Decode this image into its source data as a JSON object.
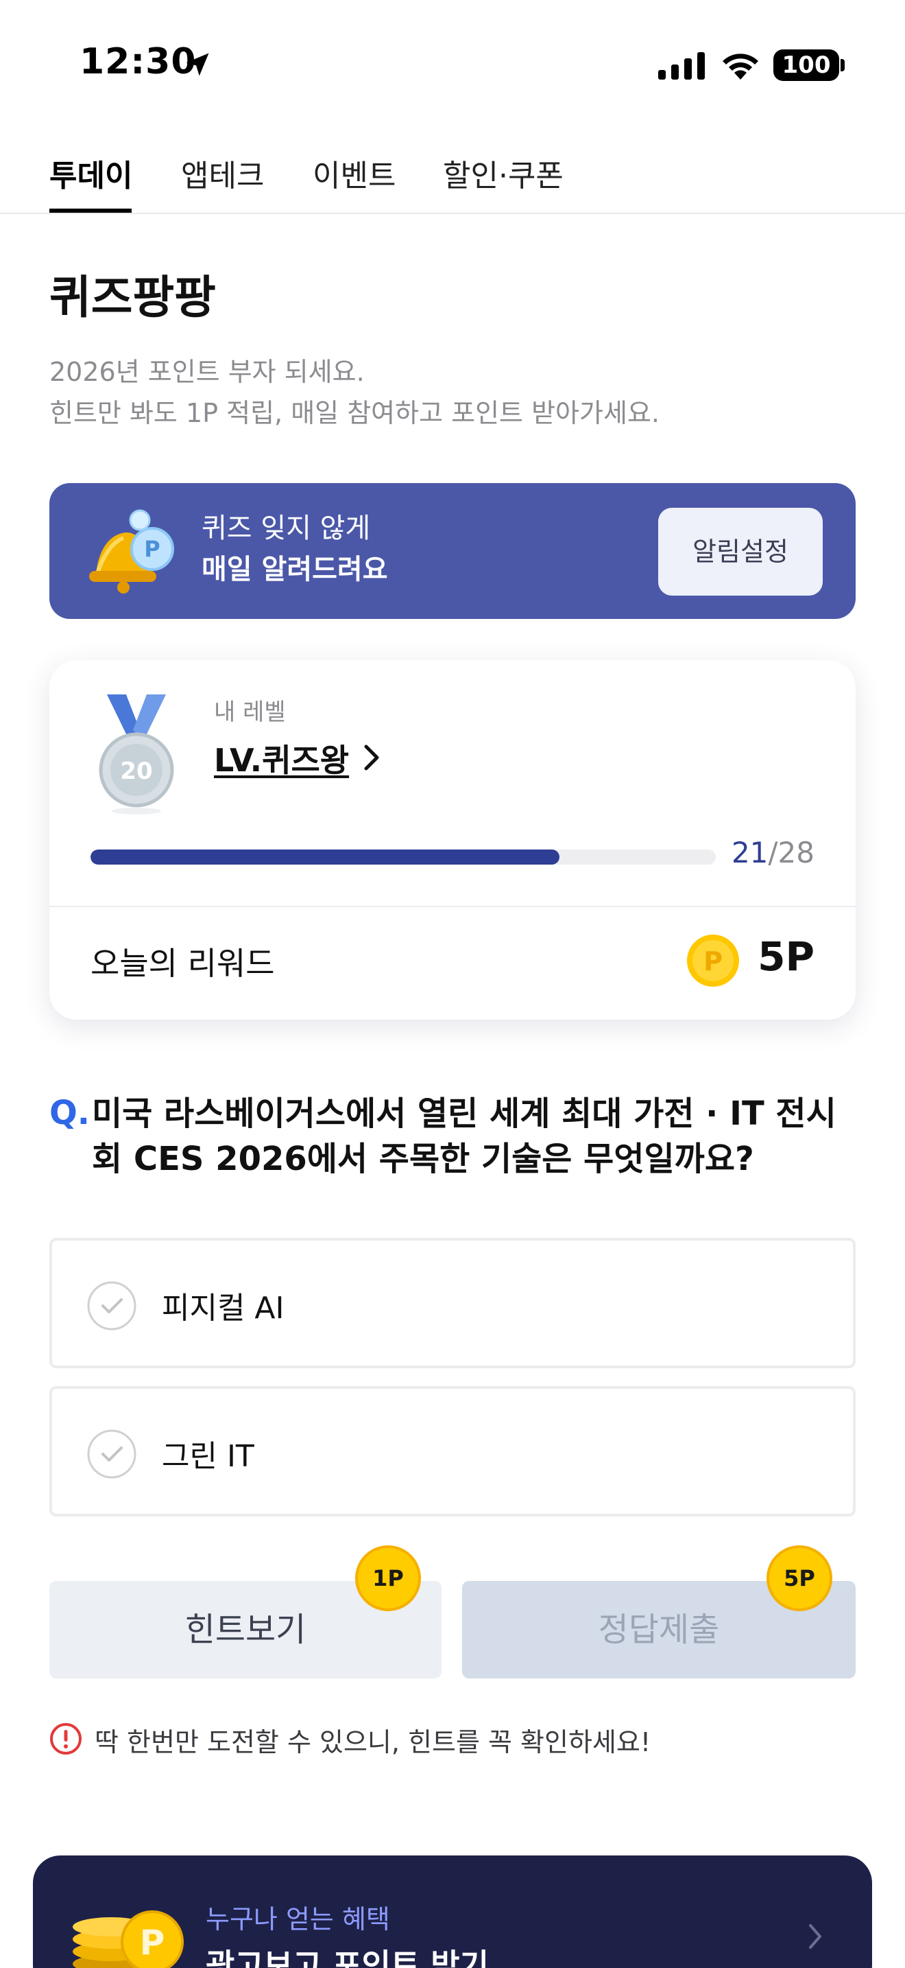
{
  "status_bar": {
    "time": "12:30",
    "battery": "100"
  },
  "tabs": [
    {
      "label": "투데이",
      "active": true
    },
    {
      "label": "앱테크",
      "active": false
    },
    {
      "label": "이벤트",
      "active": false
    },
    {
      "label": "할인·쿠폰",
      "active": false
    }
  ],
  "header": {
    "title": "퀴즈팡팡",
    "subtitle_line1": "2026년 포인트 부자 되세요.",
    "subtitle_line2": "힌트만 봐도 1P 적립, 매일 참여하고 포인트 받아가세요."
  },
  "banner": {
    "line1": "퀴즈 잊지 않게",
    "line2": "매일 알려드려요",
    "button_label": "알림설정"
  },
  "level_card": {
    "label": "내 레벨",
    "level_name": "LV.퀴즈왕",
    "medal_number": "20",
    "progress_current": "21",
    "progress_total": "/28",
    "progress_fraction": 0.75,
    "reward_label": "오늘의 리워드",
    "coin_symbol": "P",
    "reward_value": "5P"
  },
  "question": {
    "prefix": "Q.",
    "text": "미국 라스베이거스에서 열린 세계 최대 가전 · IT 전시회 CES 2026에서 주목한 기술은 무엇일까요?"
  },
  "options": [
    {
      "label": "피지컬 AI"
    },
    {
      "label": "그린 IT"
    }
  ],
  "actions": {
    "hint_label": "힌트보기",
    "hint_badge": "1P",
    "submit_label": "정답제출",
    "submit_badge": "5P"
  },
  "warning": {
    "text": "딱 한번만 도전할 수 있으니, 힌트를 꼭 확인하세요!"
  },
  "ad_banner": {
    "subtitle": "누구나 얻는 혜택",
    "title": "광고보고 포인트 받기"
  },
  "colors": {
    "accent_blue": "#2e3e95",
    "banner_bg": "#4b58a8",
    "question_prefix": "#2f67e6",
    "coin_yellow": "#ffcc00",
    "ad_bg": "#1e2147"
  }
}
